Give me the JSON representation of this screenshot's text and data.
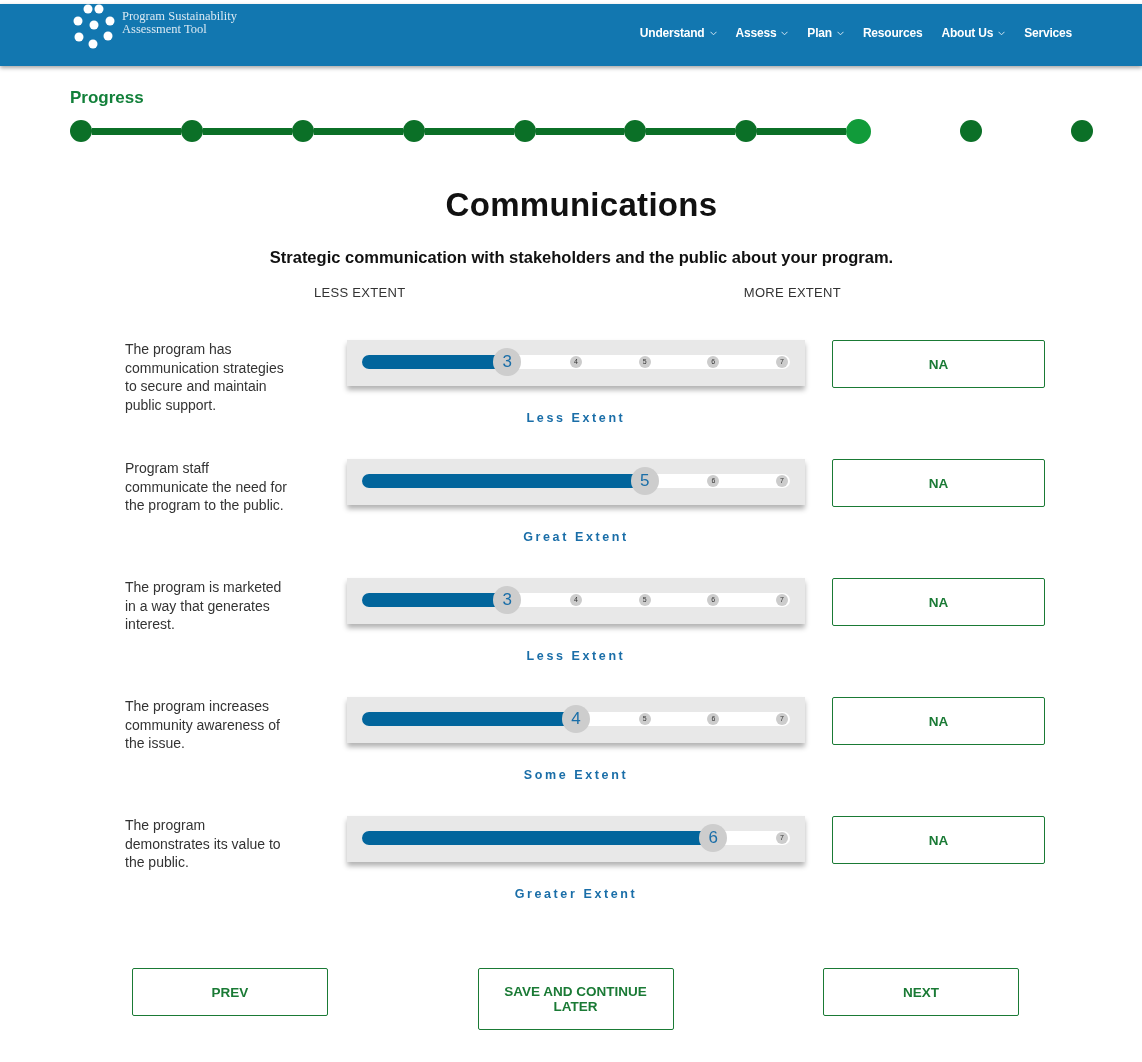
{
  "header": {
    "logo_text": [
      "Program Sustainability",
      "Assessment Tool"
    ],
    "nav": [
      {
        "label": "Understand",
        "dropdown": true
      },
      {
        "label": "Assess",
        "dropdown": true
      },
      {
        "label": "Plan",
        "dropdown": true
      },
      {
        "label": "Resources",
        "dropdown": false
      },
      {
        "label": "About Us",
        "dropdown": true
      },
      {
        "label": "Services",
        "dropdown": false
      }
    ]
  },
  "progress": {
    "title": "Progress",
    "steps": [
      {
        "completed": true,
        "selected": false
      },
      {
        "completed": true,
        "selected": false
      },
      {
        "completed": true,
        "selected": false
      },
      {
        "completed": true,
        "selected": false
      },
      {
        "completed": true,
        "selected": false
      },
      {
        "completed": true,
        "selected": false
      },
      {
        "completed": true,
        "selected": false
      },
      {
        "completed": false,
        "selected": true
      },
      {
        "completed": false,
        "selected": false
      },
      {
        "completed": false,
        "selected": false
      }
    ]
  },
  "section": {
    "title": "Communications",
    "description": "Strategic communication with stakeholders and the public about your program.",
    "scale_low": "LESS EXTENT",
    "scale_high": "MORE EXTENT"
  },
  "questions": [
    {
      "text": "The program has communication strategies to secure and maintain public support.",
      "value": "3",
      "level": 0.3333,
      "ticks": [
        "4",
        "5",
        "6",
        "7"
      ],
      "answer": "Less Extent",
      "na": "NA"
    },
    {
      "text": "Program staff communicate the need for the program to the public.",
      "value": "5",
      "level": 0.6667,
      "ticks": [
        "6",
        "7"
      ],
      "answer": "Great Extent",
      "na": "NA"
    },
    {
      "text": "The program is marketed in a way that generates interest.",
      "value": "3",
      "level": 0.3333,
      "ticks": [
        "4",
        "5",
        "6",
        "7"
      ],
      "answer": "Less Extent",
      "na": "NA"
    },
    {
      "text": "The program increases community awareness of the issue.",
      "value": "4",
      "level": 0.5,
      "ticks": [
        "5",
        "6",
        "7"
      ],
      "answer": "Some Extent",
      "na": "NA"
    },
    {
      "text": "The program demonstrates its value to the public.",
      "value": "6",
      "level": 0.8333,
      "ticks": [
        "7"
      ],
      "answer": "Greater Extent",
      "na": "NA"
    }
  ],
  "buttons": [
    "PREV",
    "SAVE AND CONTINUE LATER",
    "NEXT"
  ]
}
